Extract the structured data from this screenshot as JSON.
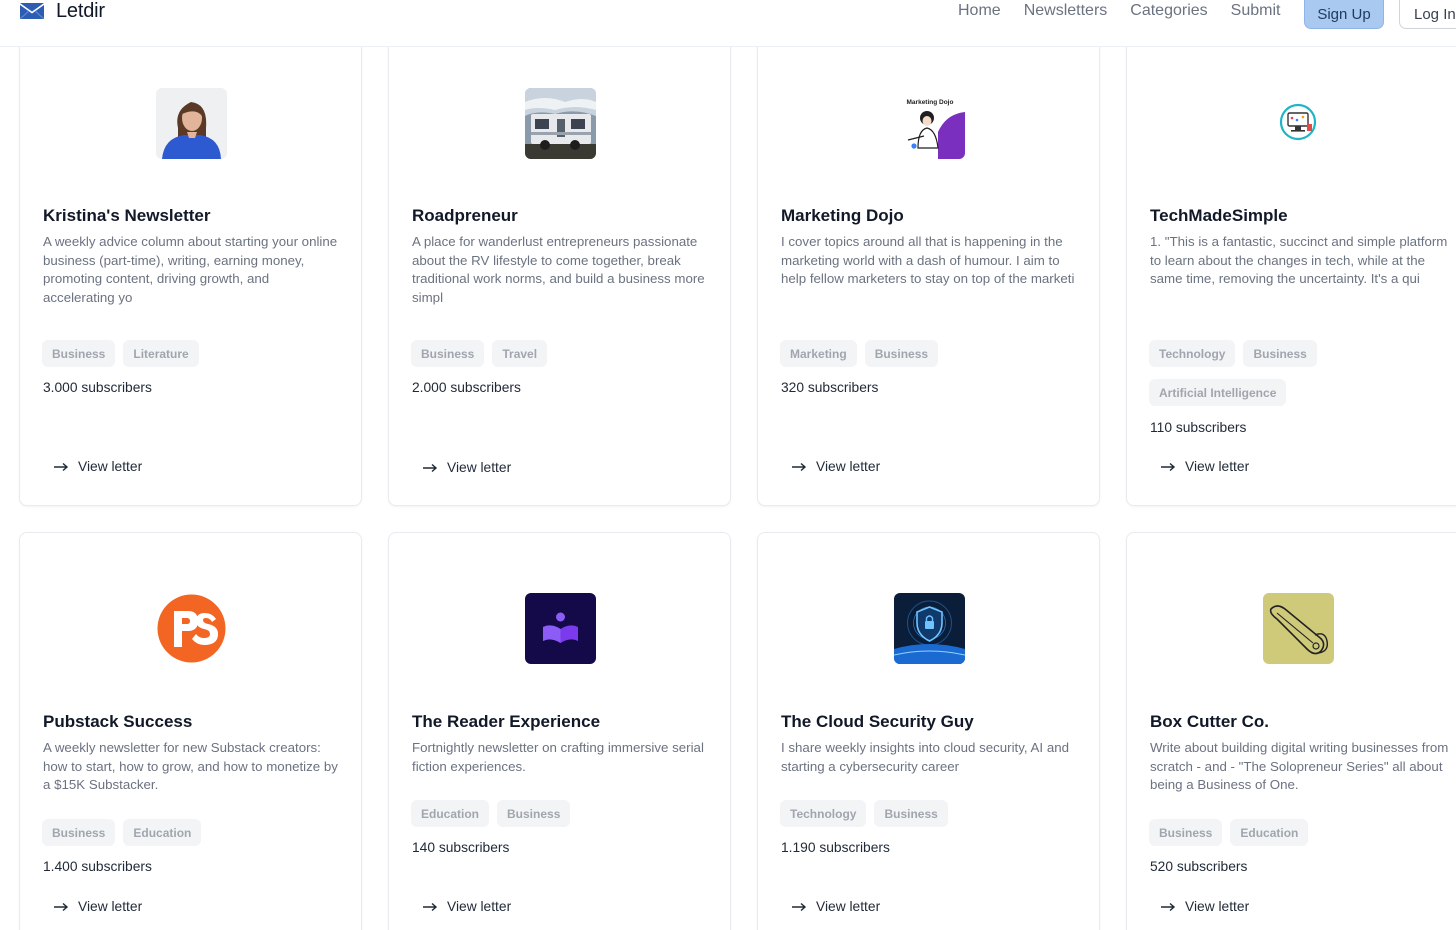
{
  "header": {
    "brand": "Letdir",
    "nav": [
      "Home",
      "Newsletters",
      "Categories",
      "Submit"
    ],
    "signup_label": "Sign Up",
    "login_label": "Log In",
    "accent_color": "#a9c9f1"
  },
  "cards": [
    {
      "title": "Kristina's Newsletter",
      "description": "A weekly advice column about starting your online business (part-time), writing, earning money, promoting content, driving growth, and accelerating yo",
      "tags": [
        "Business",
        "Literature"
      ],
      "subscribers": "3.000 subscribers",
      "link_label": "View letter",
      "icon": "portrait-icon"
    },
    {
      "title": "Roadpreneur",
      "description": "A place for wanderlust entrepreneurs passionate about the RV lifestyle to come together, break traditional work norms, and build a business more simpl",
      "tags": [
        "Business",
        "Travel"
      ],
      "subscribers": "2.000 subscribers",
      "link_label": "View letter",
      "icon": "rv-photo-icon"
    },
    {
      "title": "Marketing Dojo",
      "description": "I cover topics around all that is happening in the marketing world with a dash of humour. I aim to help fellow marketers to stay on top of the marketi",
      "tags": [
        "Marketing",
        "Business"
      ],
      "subscribers": "320 subscribers",
      "link_label": "View letter",
      "icon": "marketing-dojo-logo",
      "logo_text": "Marketing Dojo"
    },
    {
      "title": "TechMadeSimple",
      "description": "1. \"This is a fantastic, succinct and simple platform to learn about the changes in tech, while at the same time, removing the uncertainty. It's a qui",
      "tags": [
        "Technology",
        "Business",
        "Artificial Intelligence"
      ],
      "subscribers": "110 subscribers",
      "link_label": "View letter",
      "icon": "computer-badge-icon"
    },
    {
      "title": "Pubstack Success",
      "description": "A weekly newsletter for new Substack creators: how to start, how to grow, and how to monetize by a $15K Substacker.",
      "tags": [
        "Business",
        "Education"
      ],
      "subscribers": "1.400 subscribers",
      "link_label": "View letter",
      "icon": "ps-logo"
    },
    {
      "title": "The Reader Experience",
      "description": "Fortnightly newsletter on crafting immersive serial fiction experiences.",
      "tags": [
        "Education",
        "Business"
      ],
      "subscribers": "140 subscribers",
      "link_label": "View letter",
      "icon": "reader-book-icon"
    },
    {
      "title": "The Cloud Security Guy",
      "description": "I share weekly insights into cloud security, AI and starting a cybersecurity career",
      "tags": [
        "Technology",
        "Business"
      ],
      "subscribers": "1.190 subscribers",
      "link_label": "View letter",
      "icon": "security-shield-icon"
    },
    {
      "title": "Box Cutter Co.",
      "description": "Write about building digital writing businesses from scratch - and - \"The Solopreneur Series\" all about being a Business of One.",
      "tags": [
        "Business",
        "Education"
      ],
      "subscribers": "520 subscribers",
      "link_label": "View letter",
      "icon": "box-cutter-icon"
    }
  ]
}
